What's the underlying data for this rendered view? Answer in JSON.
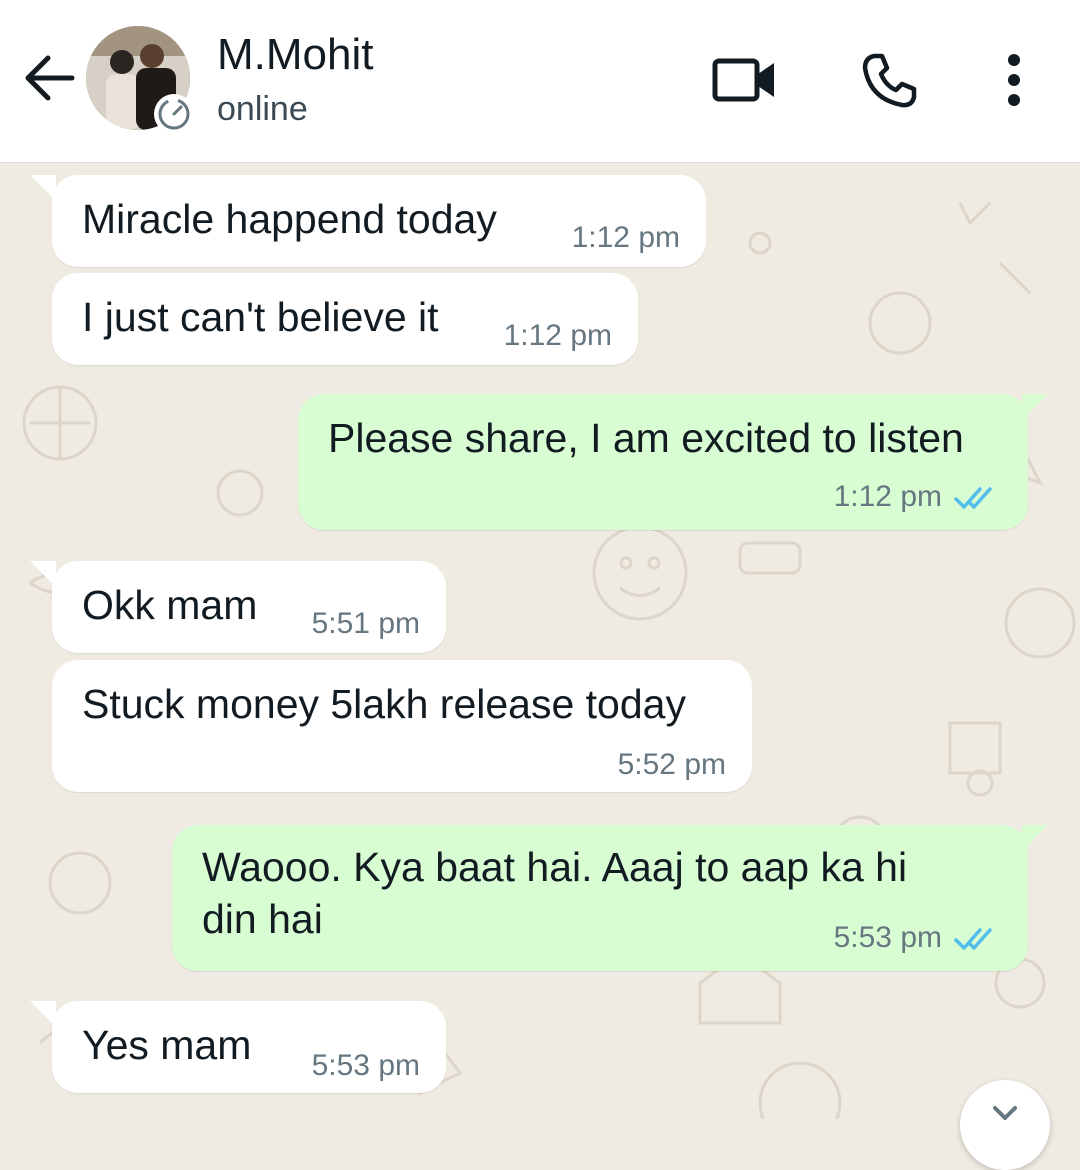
{
  "header": {
    "contact_name": "M.Mohit",
    "contact_status": "online",
    "icons": [
      "back-arrow-icon",
      "video-call-icon",
      "voice-call-icon",
      "more-options-icon"
    ]
  },
  "messages": [
    {
      "direction": "in",
      "text": "Miracle happend today",
      "time": "1:12 pm"
    },
    {
      "direction": "in",
      "text": "I just can't believe it",
      "time": "1:12 pm"
    },
    {
      "direction": "out",
      "text": "Please share, I am excited to listen",
      "time": "1:12 pm",
      "read": true
    },
    {
      "direction": "in",
      "text": "Okk mam",
      "time": "5:51 pm"
    },
    {
      "direction": "in",
      "text": "Stuck money 5lakh release today",
      "time": "5:52 pm"
    },
    {
      "direction": "out",
      "text_line1": "Waooo. Kya baat hai. Aaaj to aap ka hi",
      "text_line2": "din hai",
      "time": "5:53 pm",
      "read": true
    },
    {
      "direction": "in",
      "text": "Yes mam",
      "time": "5:53 pm"
    }
  ],
  "colors": {
    "incoming_bubble": "#ffffff",
    "outgoing_bubble": "#d9fdd3",
    "read_ticks": "#53bdeb",
    "wallpaper": "#efeae2"
  }
}
